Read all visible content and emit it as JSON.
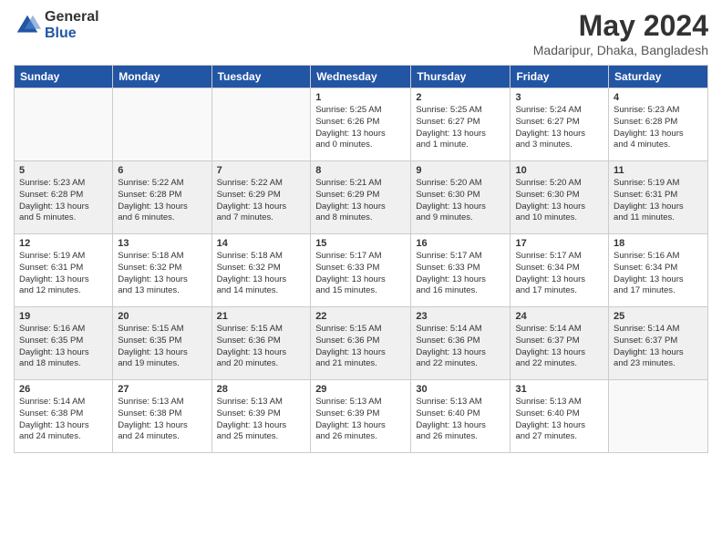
{
  "logo": {
    "general": "General",
    "blue": "Blue"
  },
  "title": "May 2024",
  "location": "Madaripur, Dhaka, Bangladesh",
  "days_of_week": [
    "Sunday",
    "Monday",
    "Tuesday",
    "Wednesday",
    "Thursday",
    "Friday",
    "Saturday"
  ],
  "weeks": [
    {
      "shaded": false,
      "days": [
        {
          "num": "",
          "info": ""
        },
        {
          "num": "",
          "info": ""
        },
        {
          "num": "",
          "info": ""
        },
        {
          "num": "1",
          "info": "Sunrise: 5:25 AM\nSunset: 6:26 PM\nDaylight: 13 hours\nand 0 minutes."
        },
        {
          "num": "2",
          "info": "Sunrise: 5:25 AM\nSunset: 6:27 PM\nDaylight: 13 hours\nand 1 minute."
        },
        {
          "num": "3",
          "info": "Sunrise: 5:24 AM\nSunset: 6:27 PM\nDaylight: 13 hours\nand 3 minutes."
        },
        {
          "num": "4",
          "info": "Sunrise: 5:23 AM\nSunset: 6:28 PM\nDaylight: 13 hours\nand 4 minutes."
        }
      ]
    },
    {
      "shaded": true,
      "days": [
        {
          "num": "5",
          "info": "Sunrise: 5:23 AM\nSunset: 6:28 PM\nDaylight: 13 hours\nand 5 minutes."
        },
        {
          "num": "6",
          "info": "Sunrise: 5:22 AM\nSunset: 6:28 PM\nDaylight: 13 hours\nand 6 minutes."
        },
        {
          "num": "7",
          "info": "Sunrise: 5:22 AM\nSunset: 6:29 PM\nDaylight: 13 hours\nand 7 minutes."
        },
        {
          "num": "8",
          "info": "Sunrise: 5:21 AM\nSunset: 6:29 PM\nDaylight: 13 hours\nand 8 minutes."
        },
        {
          "num": "9",
          "info": "Sunrise: 5:20 AM\nSunset: 6:30 PM\nDaylight: 13 hours\nand 9 minutes."
        },
        {
          "num": "10",
          "info": "Sunrise: 5:20 AM\nSunset: 6:30 PM\nDaylight: 13 hours\nand 10 minutes."
        },
        {
          "num": "11",
          "info": "Sunrise: 5:19 AM\nSunset: 6:31 PM\nDaylight: 13 hours\nand 11 minutes."
        }
      ]
    },
    {
      "shaded": false,
      "days": [
        {
          "num": "12",
          "info": "Sunrise: 5:19 AM\nSunset: 6:31 PM\nDaylight: 13 hours\nand 12 minutes."
        },
        {
          "num": "13",
          "info": "Sunrise: 5:18 AM\nSunset: 6:32 PM\nDaylight: 13 hours\nand 13 minutes."
        },
        {
          "num": "14",
          "info": "Sunrise: 5:18 AM\nSunset: 6:32 PM\nDaylight: 13 hours\nand 14 minutes."
        },
        {
          "num": "15",
          "info": "Sunrise: 5:17 AM\nSunset: 6:33 PM\nDaylight: 13 hours\nand 15 minutes."
        },
        {
          "num": "16",
          "info": "Sunrise: 5:17 AM\nSunset: 6:33 PM\nDaylight: 13 hours\nand 16 minutes."
        },
        {
          "num": "17",
          "info": "Sunrise: 5:17 AM\nSunset: 6:34 PM\nDaylight: 13 hours\nand 17 minutes."
        },
        {
          "num": "18",
          "info": "Sunrise: 5:16 AM\nSunset: 6:34 PM\nDaylight: 13 hours\nand 17 minutes."
        }
      ]
    },
    {
      "shaded": true,
      "days": [
        {
          "num": "19",
          "info": "Sunrise: 5:16 AM\nSunset: 6:35 PM\nDaylight: 13 hours\nand 18 minutes."
        },
        {
          "num": "20",
          "info": "Sunrise: 5:15 AM\nSunset: 6:35 PM\nDaylight: 13 hours\nand 19 minutes."
        },
        {
          "num": "21",
          "info": "Sunrise: 5:15 AM\nSunset: 6:36 PM\nDaylight: 13 hours\nand 20 minutes."
        },
        {
          "num": "22",
          "info": "Sunrise: 5:15 AM\nSunset: 6:36 PM\nDaylight: 13 hours\nand 21 minutes."
        },
        {
          "num": "23",
          "info": "Sunrise: 5:14 AM\nSunset: 6:36 PM\nDaylight: 13 hours\nand 22 minutes."
        },
        {
          "num": "24",
          "info": "Sunrise: 5:14 AM\nSunset: 6:37 PM\nDaylight: 13 hours\nand 22 minutes."
        },
        {
          "num": "25",
          "info": "Sunrise: 5:14 AM\nSunset: 6:37 PM\nDaylight: 13 hours\nand 23 minutes."
        }
      ]
    },
    {
      "shaded": false,
      "days": [
        {
          "num": "26",
          "info": "Sunrise: 5:14 AM\nSunset: 6:38 PM\nDaylight: 13 hours\nand 24 minutes."
        },
        {
          "num": "27",
          "info": "Sunrise: 5:13 AM\nSunset: 6:38 PM\nDaylight: 13 hours\nand 24 minutes."
        },
        {
          "num": "28",
          "info": "Sunrise: 5:13 AM\nSunset: 6:39 PM\nDaylight: 13 hours\nand 25 minutes."
        },
        {
          "num": "29",
          "info": "Sunrise: 5:13 AM\nSunset: 6:39 PM\nDaylight: 13 hours\nand 26 minutes."
        },
        {
          "num": "30",
          "info": "Sunrise: 5:13 AM\nSunset: 6:40 PM\nDaylight: 13 hours\nand 26 minutes."
        },
        {
          "num": "31",
          "info": "Sunrise: 5:13 AM\nSunset: 6:40 PM\nDaylight: 13 hours\nand 27 minutes."
        },
        {
          "num": "",
          "info": ""
        }
      ]
    }
  ]
}
